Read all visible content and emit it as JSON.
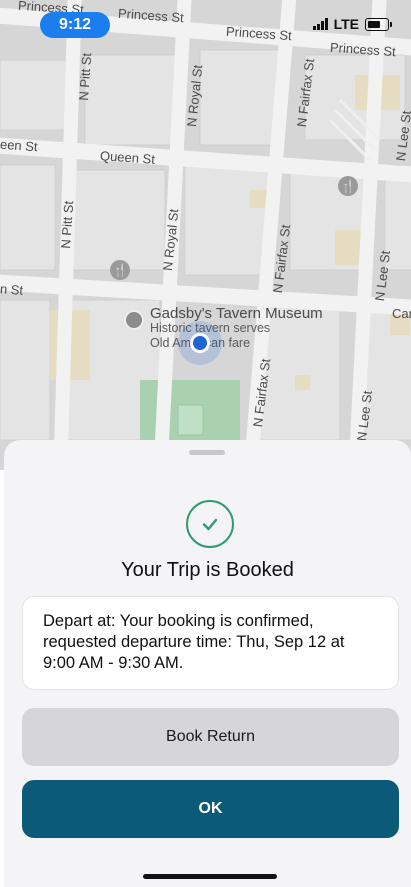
{
  "status_bar": {
    "time": "9:12",
    "network": "LTE"
  },
  "map": {
    "streets": {
      "princess_1": "Princess St",
      "princess_2": "Princess St",
      "princess_3": "Princess St",
      "queen_1": "Queen St",
      "queen_2": "een St",
      "n_pitt_1": "N Pitt St",
      "n_pitt_2": "N Pitt St",
      "n_royal_1": "N Royal St",
      "n_royal_2": "N Royal St",
      "n_fairfax_1": "N Fairfax St",
      "n_fairfax_2": "N Fairfax St",
      "n_fairfax_3": "N Fairfax St",
      "n_lee_1": "N Lee St",
      "n_lee_2": "N Lee St",
      "n_lee_3": "N Lee St",
      "cam": "Cam",
      "n_st": "n St"
    },
    "poi": {
      "title": "Gadsby's Tavern Museum",
      "desc_line1": "Historic tavern serves",
      "desc_line2": "Old American fare"
    }
  },
  "sheet": {
    "title": "Your Trip is Booked",
    "message": "Depart at: Your booking is confirmed, requested departure time: Thu, Sep 12 at 9:00 AM - 9:30 AM.",
    "book_return_label": "Book Return",
    "ok_label": "OK"
  },
  "colors": {
    "primary": "#0b5a78",
    "success": "#2e9a6f",
    "location": "#1f64d6",
    "time_pill": "#1a7df0"
  }
}
